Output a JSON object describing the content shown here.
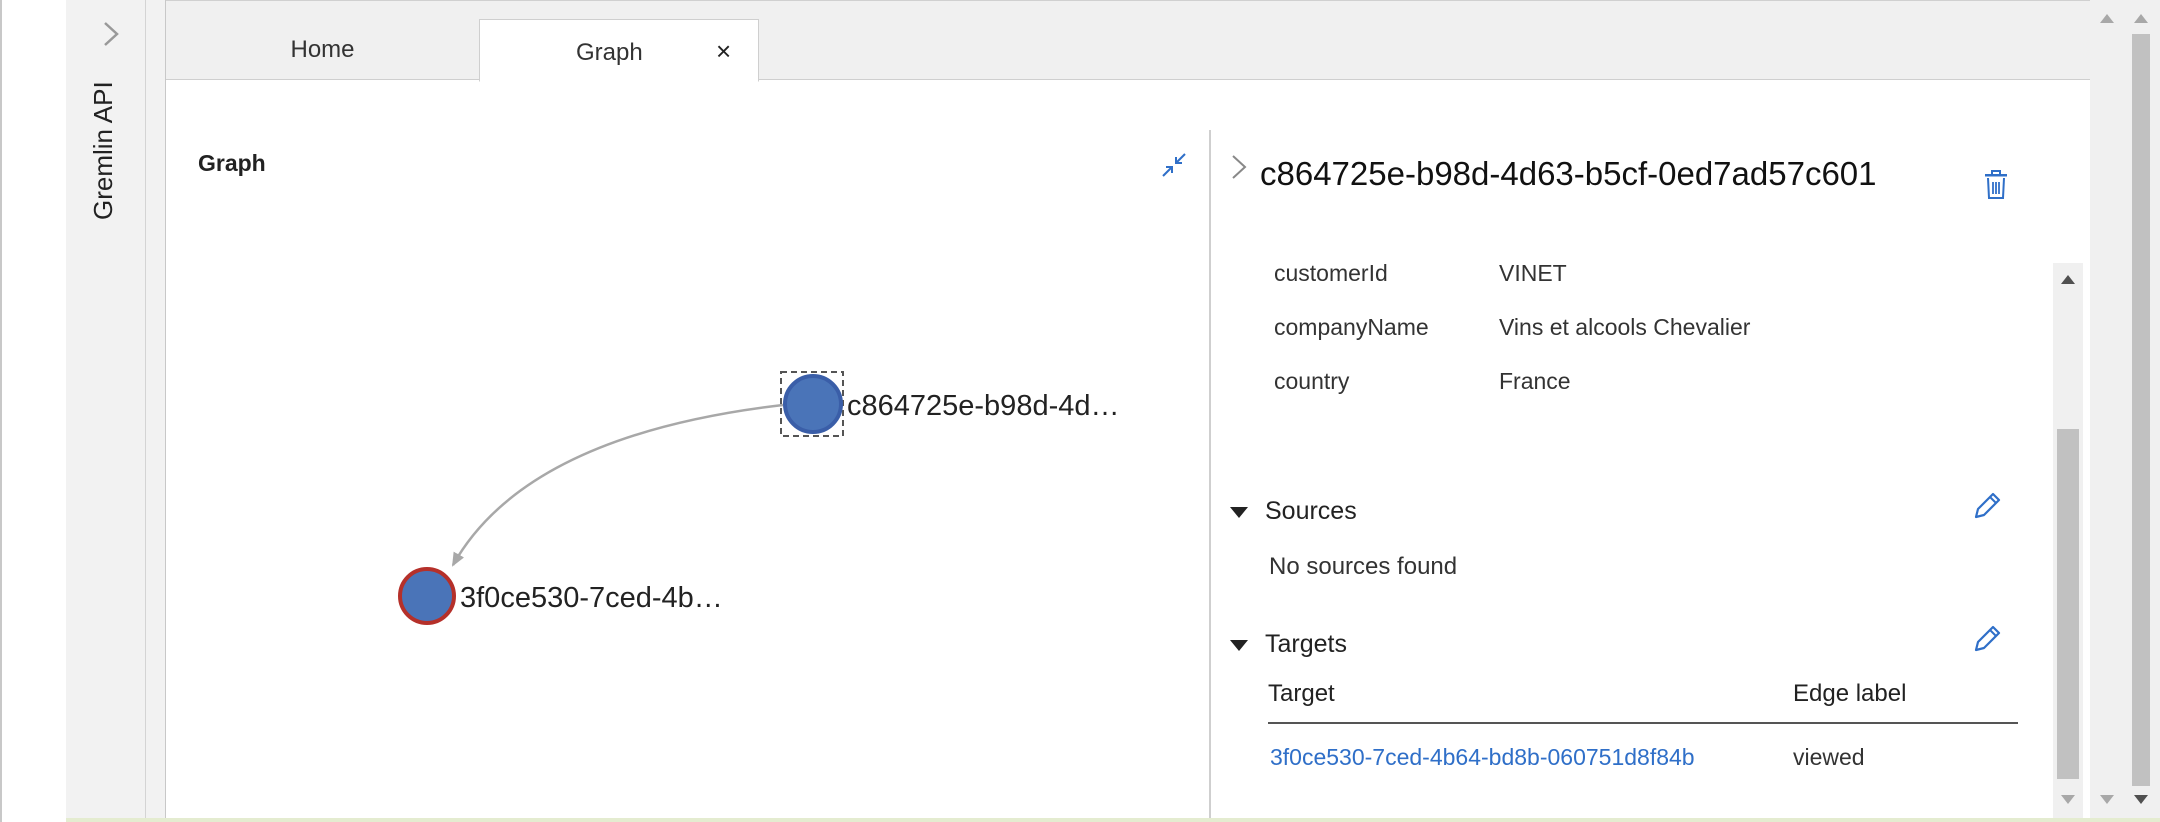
{
  "rail": {
    "title": "Gremlin API"
  },
  "tabs": [
    {
      "label": "Home"
    },
    {
      "label": "Graph",
      "close_glyph": "×"
    }
  ],
  "graph": {
    "title": "Graph",
    "nodes": [
      {
        "label": "c864725e-b98d-4d…",
        "selected": true,
        "fill": "#4a74b8",
        "stroke": "#3a5ea8"
      },
      {
        "label": "3f0ce530-7ced-4b…",
        "selected": false,
        "fill": "#4a74b8",
        "stroke": "#b5302a"
      }
    ],
    "edge_color": "#a8a8a8"
  },
  "detail": {
    "title": "c864725e-b98d-4d63-b5cf-0ed7ad57c601",
    "properties": [
      {
        "key": "customerId",
        "value": "VINET"
      },
      {
        "key": "companyName",
        "value": "Vins et alcools Chevalier"
      },
      {
        "key": "country",
        "value": "France"
      }
    ],
    "sources": {
      "title": "Sources",
      "empty_text": "No sources found"
    },
    "targets": {
      "title": "Targets",
      "col_target": "Target",
      "col_edge": "Edge label",
      "rows": [
        {
          "target": "3f0ce530-7ced-4b64-bd8b-060751d8f84b",
          "edge_label": "viewed"
        }
      ]
    }
  },
  "colors": {
    "link": "#2f6fc8",
    "icon_blue": "#2f6fc8"
  }
}
